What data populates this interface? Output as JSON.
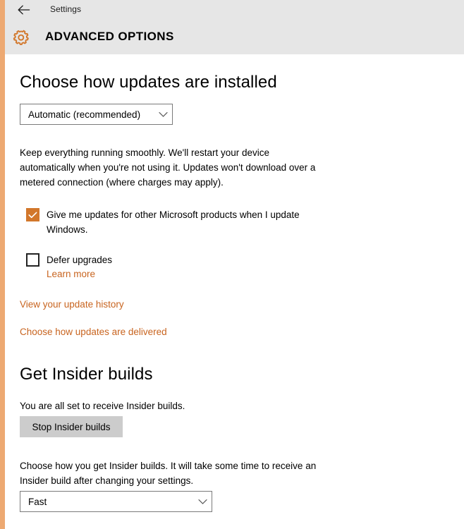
{
  "window": {
    "back_icon": "back-arrow-icon",
    "title": "Settings"
  },
  "header": {
    "icon": "gear-icon",
    "title": "ADVANCED OPTIONS"
  },
  "colors": {
    "accent_orange": "#d2772b",
    "link_orange": "#c8641f",
    "stripe": "#eda972",
    "header_bg": "#e6e6e6",
    "button_bg": "#cccccc",
    "page_bg": "#ffffff"
  },
  "updates_section": {
    "heading": "Choose how updates are installed",
    "install_mode": {
      "value": "Automatic (recommended)",
      "chevron_icon": "chevron-down-icon",
      "options": [
        "Automatic (recommended)"
      ]
    },
    "description": "Keep everything running smoothly. We'll restart your device automatically when you're not using it. Updates won't download over a metered connection (where charges may apply).",
    "microsoft_products_checkbox": {
      "label": "Give me updates for other Microsoft products when I update Windows.",
      "checked": true,
      "check_icon": "checkmark-icon"
    },
    "defer_upgrades_checkbox": {
      "label": "Defer upgrades",
      "checked": false
    },
    "learn_more_link": "Learn more",
    "update_history_link": "View your update history",
    "updates_delivered_link": "Choose how updates are delivered"
  },
  "insider_section": {
    "heading": "Get Insider builds",
    "status_text": "You are all set to receive Insider builds.",
    "stop_button_label": "Stop Insider builds",
    "description": "Choose how you get Insider builds. It will take some time to receive an Insider build after changing your settings.",
    "ring": {
      "value": "Fast",
      "chevron_icon": "chevron-down-icon",
      "options": [
        "Fast"
      ]
    }
  }
}
